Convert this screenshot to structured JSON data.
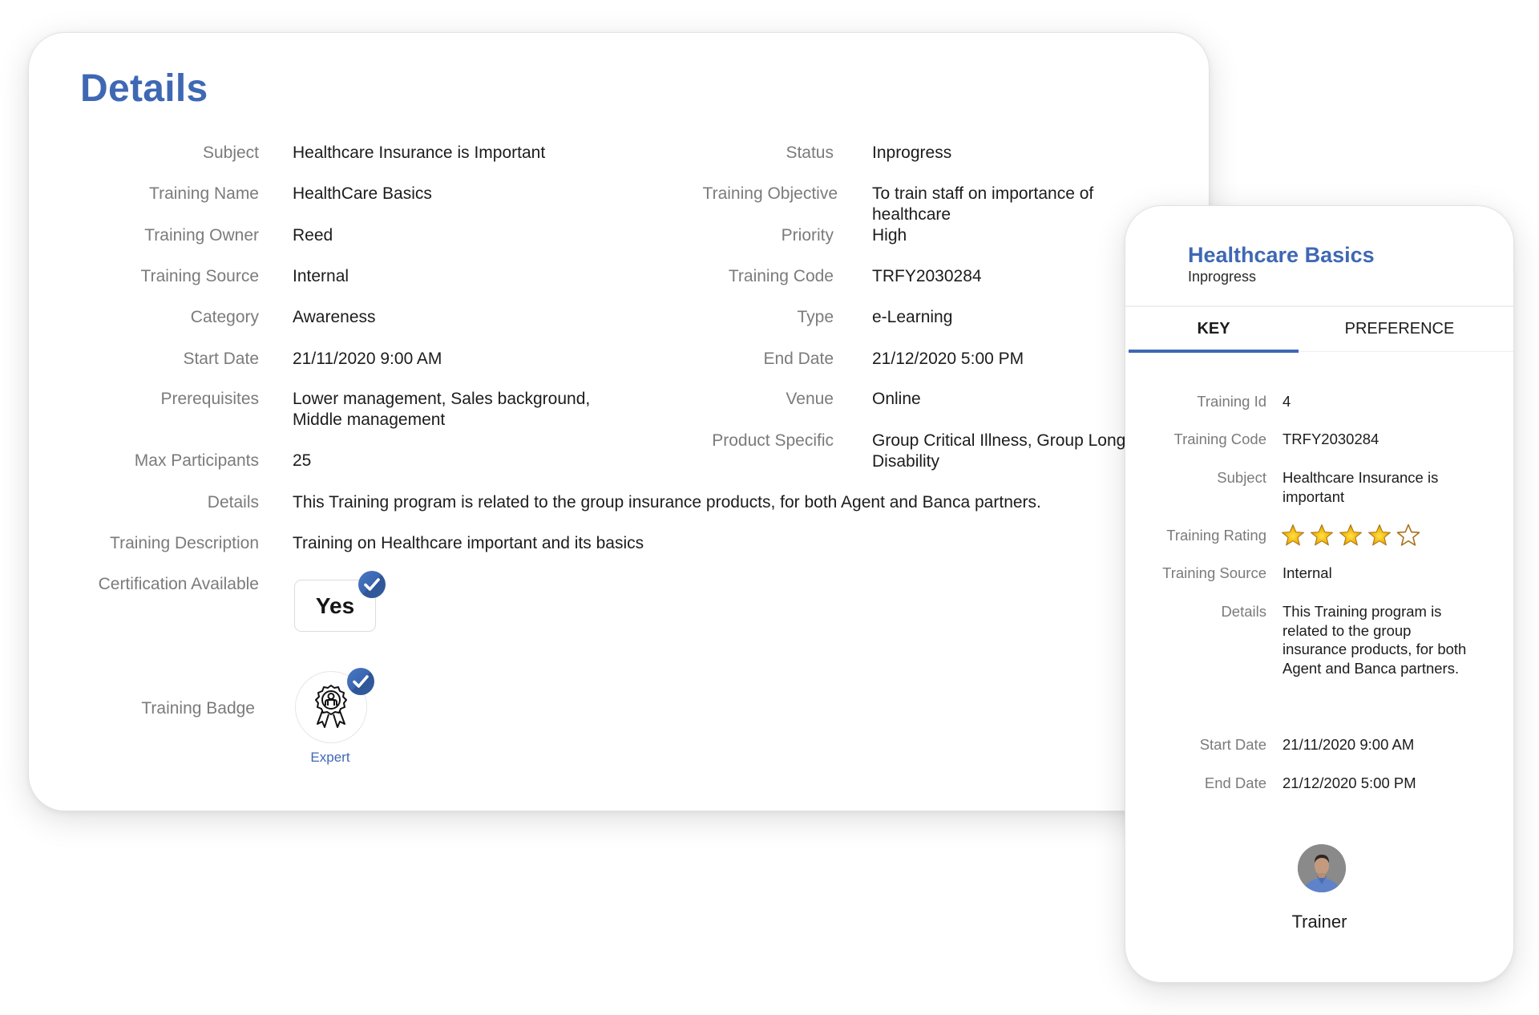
{
  "main": {
    "title": "Details",
    "left_fields": [
      {
        "label": "Subject",
        "value": "Healthcare Insurance is Important"
      },
      {
        "label": "Training Name",
        "value": "HealthCare Basics"
      },
      {
        "label": "Training Owner",
        "value": "Reed"
      },
      {
        "label": "Training Source",
        "value": "Internal"
      },
      {
        "label": "Category",
        "value": "Awareness"
      },
      {
        "label": "Start Date",
        "value": "21/11/2020 9:00 AM"
      },
      {
        "label": "Prerequisites",
        "value": "Lower management, Sales background, Middle management"
      },
      {
        "label": "Max Participants",
        "value": "25"
      },
      {
        "label": "Details",
        "value": "This Training program is related to the group insurance products, for both Agent and Banca partners."
      },
      {
        "label": "Training Description",
        "value": "Training on Healthcare important and its basics"
      }
    ],
    "right_fields": [
      {
        "label": "Status",
        "value": "Inprogress"
      },
      {
        "label": "Training Objective",
        "value": "To train staff on importance of healthcare"
      },
      {
        "label": "Priority",
        "value": "High"
      },
      {
        "label": "Training Code",
        "value": "TRFY2030284"
      },
      {
        "label": "Type",
        "value": "e-Learning"
      },
      {
        "label": "End Date",
        "value": "21/12/2020 5:00 PM"
      },
      {
        "label": "Venue",
        "value": "Online"
      },
      {
        "label": "Product Specific",
        "value": "Group Critical Illness, Group Long Term Disability"
      }
    ],
    "certification": {
      "label": "Certification Available",
      "value": "Yes",
      "checked": true
    },
    "badge": {
      "label": "Training Badge",
      "name": "Expert",
      "icon": "award-ribbon-icon",
      "checked": true
    }
  },
  "side": {
    "title": "Healthcare Basics",
    "status": "Inprogress",
    "tabs": [
      {
        "label": "KEY",
        "active": true
      },
      {
        "label": "PREFERENCE",
        "active": false
      }
    ],
    "fields": {
      "training_id": {
        "label": "Training Id",
        "value": "4"
      },
      "training_code": {
        "label": "Training Code",
        "value": "TRFY2030284"
      },
      "subject": {
        "label": "Subject",
        "value": "Healthcare Insurance is important"
      },
      "rating": {
        "label": "Training Rating",
        "value": 4,
        "max": 5
      },
      "source": {
        "label": "Training Source",
        "value": "Internal"
      },
      "details": {
        "label": "Details",
        "value": "This Training program is related to the group insurance products, for both Agent and Banca partners."
      },
      "start_date": {
        "label": "Start Date",
        "value": "21/11/2020 9:00 AM"
      },
      "end_date": {
        "label": "End Date",
        "value": "21/12/2020 5:00 PM"
      }
    },
    "trainer": {
      "label": "Trainer",
      "avatar": "trainer-avatar"
    }
  },
  "colors": {
    "accent": "#3f68b4",
    "label": "#7b7b7b",
    "text": "#1c1c1c",
    "star_fill": "#f2b705",
    "star_outline": "#a8721c"
  }
}
